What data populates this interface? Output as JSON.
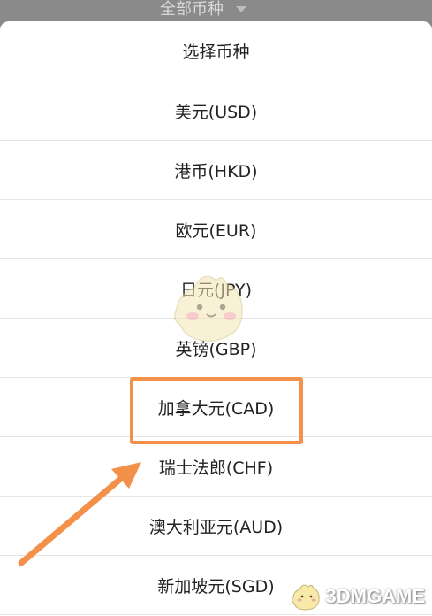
{
  "top_filter": {
    "label": "全部币种"
  },
  "sheet": {
    "title": "选择币种",
    "options": [
      {
        "label": "美元(USD)"
      },
      {
        "label": "港币(HKD)"
      },
      {
        "label": "欧元(EUR)"
      },
      {
        "label": "日元(JPY)"
      },
      {
        "label": "英镑(GBP)"
      },
      {
        "label": "加拿大元(CAD)"
      },
      {
        "label": "瑞士法郎(CHF)"
      },
      {
        "label": "澳大利亚元(AUD)"
      },
      {
        "label": "新加坡元(SGD)"
      }
    ],
    "highlighted_option": "加拿大元(CAD)"
  },
  "annotation": {
    "color": "#f3914a"
  },
  "watermark": {
    "text": "3DMGAME"
  }
}
